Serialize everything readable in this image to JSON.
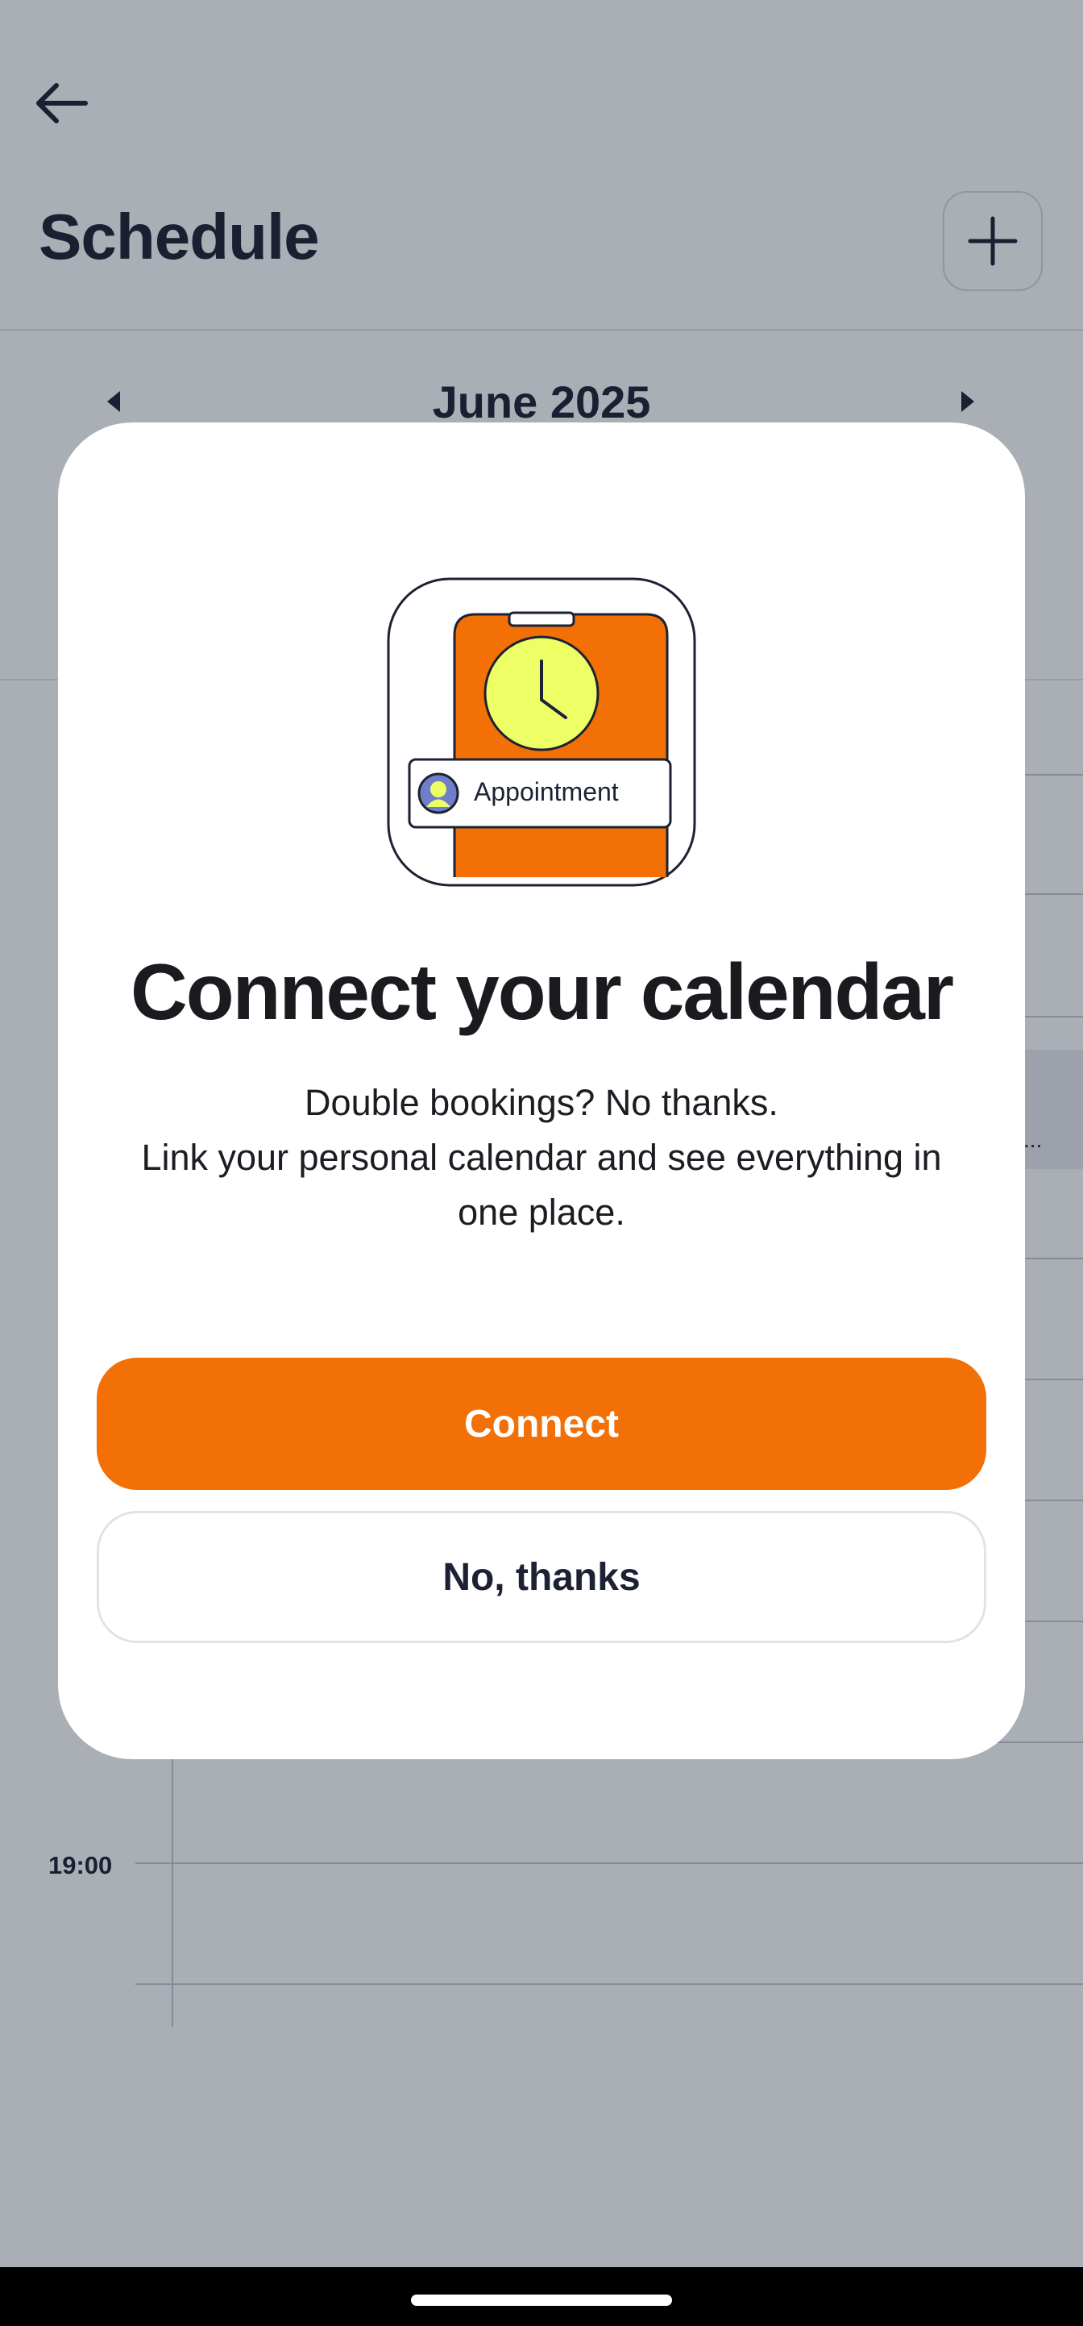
{
  "header": {
    "back_icon": "arrow-left-icon",
    "title": "Schedule",
    "add_icon": "plus-icon"
  },
  "calendar": {
    "month_label": "June 2025",
    "prev_icon": "caret-left-icon",
    "next_icon": "caret-right-icon"
  },
  "timeline": {
    "visible_label": "19:00",
    "event_snippet": "..."
  },
  "modal": {
    "illustration": {
      "icon": "phone-clock-icon",
      "chip_label": "Appointment"
    },
    "title": "Connect your calendar",
    "body_lines": [
      "Double bookings? No thanks.",
      "Link your personal calendar and see everything in",
      "one place."
    ],
    "primary_button": "Connect",
    "secondary_button": "No, thanks"
  },
  "colors": {
    "accent": "#F27006",
    "text_dark": "#1C2233",
    "illustration_yellow": "#EEFF66",
    "scrim": "rgba(20,30,50,0.36)"
  }
}
